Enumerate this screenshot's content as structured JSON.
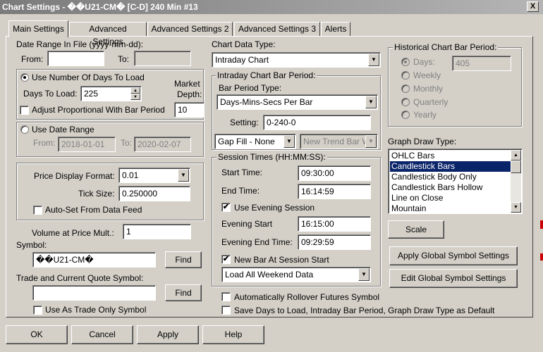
{
  "window": {
    "title": "Chart Settings - ��U21-CM� [C-D]  240 Min   #13",
    "close": "X"
  },
  "tabs": [
    "Main Settings",
    "Advanced Settings",
    "Advanced Settings 2",
    "Advanced Settings 3",
    "Alerts"
  ],
  "date_range": {
    "label": "Date Range In File (yyyy-mm-dd):",
    "from_label": "From:",
    "from_value": "",
    "to_label": "To:",
    "to_value": ""
  },
  "days_group": {
    "use_days_label": "Use Number Of Days To Load",
    "use_days_selected": true,
    "days_to_load_label": "Days To Load:",
    "days_to_load_value": "225",
    "market_depth_label_1": "Market",
    "market_depth_label_2": "Depth:",
    "market_depth_value": "10",
    "adjust_label": "Adjust Proportional With Bar Period",
    "adjust_checked": false
  },
  "date_range_group": {
    "use_date_range_label": "Use Date Range",
    "use_date_range_selected": false,
    "from_label": "From:",
    "from_value": "2018-01-01",
    "to_label": "To:",
    "to_value": "2020-02-07"
  },
  "price_group": {
    "format_label": "Price Display Format:",
    "format_value": "0.01",
    "tick_label": "Tick Size:",
    "tick_value": "0.250000",
    "autoset_label": "Auto-Set From Data Feed",
    "autoset_checked": false
  },
  "volume": {
    "label": "Volume at Price Mult.:",
    "value": "1"
  },
  "symbol": {
    "label": "Symbol:",
    "value": "��U21-CM�",
    "find": "Find"
  },
  "trade_symbol": {
    "label": "Trade and Current Quote Symbol:",
    "value": "",
    "find": "Find"
  },
  "trade_only": {
    "label": "Use As Trade Only Symbol",
    "checked": false
  },
  "chart_data_type": {
    "label": "Chart Data Type:",
    "value": "Intraday Chart"
  },
  "intraday_group": {
    "label": "Intraday Chart Bar Period:",
    "bar_period_type_label": "Bar Period Type:",
    "bar_period_type_value": "Days-Mins-Secs Per Bar",
    "setting_label": "Setting:",
    "setting_value": "0-240-0",
    "gap_fill_value": "Gap Fill - None",
    "new_trend_value": "New Trend Bar W"
  },
  "session_group": {
    "label": "Session Times (HH:MM:SS):",
    "start_label": "Start Time:",
    "start_value": "09:30:00",
    "end_label": "End Time:",
    "end_value": "16:14:59",
    "use_evening_label": "Use Evening Session",
    "use_evening_checked": true,
    "evening_start_label": "Evening Start",
    "evening_start_value": "16:15:00",
    "evening_end_label": "Evening End Time:",
    "evening_end_value": "09:29:59",
    "new_bar_label": "New Bar At Session Start",
    "new_bar_checked": true,
    "weekend_value": "Load All Weekend Data"
  },
  "historical_group": {
    "label": "Historical Chart Bar Period:",
    "options": [
      "Days:",
      "Weekly",
      "Monthly",
      "Quarterly",
      "Yearly"
    ],
    "days_value": "405"
  },
  "graph_draw": {
    "label": "Graph Draw Type:",
    "items": [
      "OHLC Bars",
      "Candlestick Bars",
      "Candlestick Body Only",
      "Candlestick Bars Hollow",
      "Line on Close",
      "Mountain"
    ],
    "selected": "Candlestick Bars"
  },
  "scale_button": "Scale",
  "apply_global_button": "Apply Global Symbol Settings",
  "edit_global_button": "Edit Global Symbol Settings",
  "auto_rollover": {
    "label": "Automatically Rollover Futures Symbol",
    "checked": false
  },
  "save_defaults": {
    "label": "Save Days to Load, Intraday Bar Period, Graph Draw Type as Default",
    "checked": false
  },
  "footer": {
    "ok": "OK",
    "cancel": "Cancel",
    "apply": "Apply",
    "help": "Help"
  },
  "icons": {
    "check": "✔",
    "dropdown": "▼",
    "up": "▲",
    "down": "▼"
  },
  "colors": {
    "selection": "#0a246a",
    "titlebar": "#7b7b7b",
    "face": "#d4d0c8"
  }
}
